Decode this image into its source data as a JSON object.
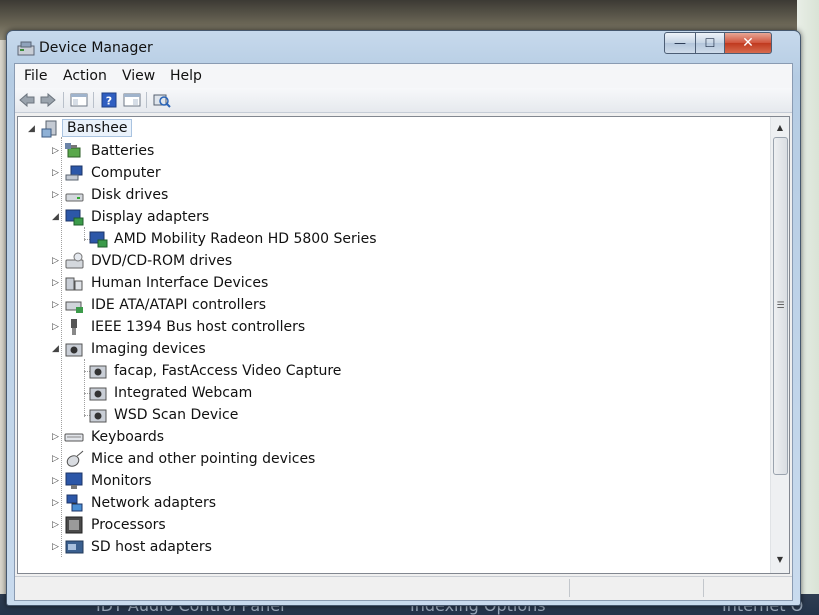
{
  "window": {
    "title": "Device Manager"
  },
  "controls": {
    "minimize": "—",
    "maximize": "☐",
    "close": "✕"
  },
  "menu": [
    "File",
    "Action",
    "View",
    "Help"
  ],
  "tree": {
    "root": "Banshee",
    "nodes": [
      {
        "label": "Batteries",
        "icon": "battery-icon",
        "expanded": false
      },
      {
        "label": "Computer",
        "icon": "computer-icon",
        "expanded": false
      },
      {
        "label": "Disk drives",
        "icon": "disk-drive-icon",
        "expanded": false
      },
      {
        "label": "Display adapters",
        "icon": "display-adapter-icon",
        "expanded": true,
        "children": [
          "AMD Mobility Radeon HD 5800 Series"
        ]
      },
      {
        "label": "DVD/CD-ROM drives",
        "icon": "dvd-drive-icon",
        "expanded": false
      },
      {
        "label": "Human Interface Devices",
        "icon": "hid-icon",
        "expanded": false
      },
      {
        "label": "IDE ATA/ATAPI controllers",
        "icon": "ide-controller-icon",
        "expanded": false
      },
      {
        "label": "IEEE 1394 Bus host controllers",
        "icon": "ieee1394-icon",
        "expanded": false
      },
      {
        "label": "Imaging devices",
        "icon": "imaging-device-icon",
        "expanded": true,
        "children": [
          "facap, FastAccess Video Capture",
          "Integrated Webcam",
          "WSD Scan Device"
        ]
      },
      {
        "label": "Keyboards",
        "icon": "keyboard-icon",
        "expanded": false
      },
      {
        "label": "Mice and other pointing devices",
        "icon": "mouse-icon",
        "expanded": false
      },
      {
        "label": "Monitors",
        "icon": "monitor-icon",
        "expanded": false
      },
      {
        "label": "Network adapters",
        "icon": "network-adapter-icon",
        "expanded": false
      },
      {
        "label": "Processors",
        "icon": "processor-icon",
        "expanded": false
      },
      {
        "label": "SD host adapters",
        "icon": "sd-host-icon",
        "expanded": false
      }
    ]
  },
  "background": {
    "taskbar_items": [
      "IDT Audio Control Panel",
      "Indexing Options",
      "Internet O"
    ]
  }
}
